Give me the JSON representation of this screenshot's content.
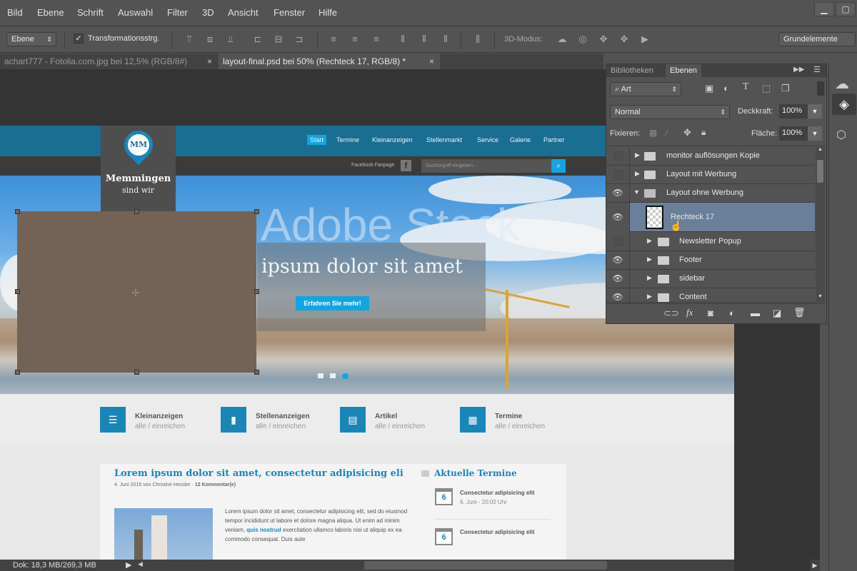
{
  "menubar": {
    "items": [
      "Bild",
      "Ebene",
      "Schrift",
      "Auswahl",
      "Filter",
      "3D",
      "Ansicht",
      "Fenster",
      "Hilfe"
    ],
    "minimize_icon": "minimize-icon",
    "maximize_icon": "maximize-icon"
  },
  "options": {
    "tool_select": "Ebene",
    "transform_label": "Transformationsstrg.",
    "transform_checked": true,
    "mode3d_label": "3D-Modus:",
    "workspace": "Grundelemente"
  },
  "tabs": [
    {
      "label": "achart777 - Fotolia.com.jpg bei 12,5% (RGB/8#)",
      "active": false
    },
    {
      "label": "layout-final.psd bei 50% (Rechteck 17, RGB/8) *",
      "active": true
    }
  ],
  "website": {
    "nav": [
      "Start",
      "Termine",
      "Kleinanzeigen",
      "Stellenmarkt",
      "Service",
      "Galerie",
      "Partner"
    ],
    "facebook_label": "Facebook Fanpage",
    "search_placeholder": "Suchbegriff eingeben...",
    "logo_initials": "MM",
    "logo_title": "Memmingen",
    "logo_subtitle": "sind wir",
    "hero_watermark": "Adobe Stock",
    "hero_title": "n ipsum dolor sit amet",
    "hero_button": "Erfahren Sie mehr!",
    "features": [
      {
        "title": "Kleinanzeigen",
        "sub": "alle / einreichen",
        "icon": "list-icon"
      },
      {
        "title": "Stellenanzeigen",
        "sub": "alle / einreichen",
        "icon": "briefcase-icon"
      },
      {
        "title": "Artikel",
        "sub": "alle / einreichen",
        "icon": "article-icon"
      },
      {
        "title": "Termine",
        "sub": "alle / einreichen",
        "icon": "calendar-icon"
      }
    ],
    "post": {
      "title": "Lorem ipsum dolor sit amet, consectetur adipisicing eli",
      "meta": "4. Juni 2015 von Christine Hessler · ",
      "comments": "12 Kommentar(e)",
      "body1": "Lorem ipsum dolor sit amet, consectetur adipisicing elit, sed do eiusmod tempor incididunt ut labore et dolore magna aliqua. Ut enim ad minim veniam, ",
      "body_link": "quis nostrud",
      "body2": " exercitation ullamco laboris nisi ut aliquip ex ea commodo consequat. Duis aute"
    },
    "sidebar": {
      "title": "Aktuelle Termine",
      "events": [
        {
          "day": "6",
          "title": "Consectetur adipisicing elit",
          "date": "6. Juni - 20:00 Uhr"
        },
        {
          "day": "6",
          "title": "Consectetur adipisicing elit",
          "date": ""
        }
      ]
    }
  },
  "layers_panel": {
    "tabs": [
      "Bibliotheken",
      "Ebenen"
    ],
    "active_tab": "Ebenen",
    "filter": "Art",
    "blend_mode": "Normal",
    "opacity_label": "Deckkraft:",
    "opacity": "100%",
    "lock_label": "Fixieren:",
    "fill_label": "Fläche:",
    "fill": "100%",
    "layers": [
      {
        "name": "monitor auflösungen Kopie",
        "visible": false,
        "type": "group",
        "expanded": false,
        "indent": 0
      },
      {
        "name": "Layout mit Werbung",
        "visible": false,
        "type": "group",
        "expanded": false,
        "indent": 0
      },
      {
        "name": "Layout ohne Werbung",
        "visible": true,
        "type": "group",
        "expanded": true,
        "indent": 0
      },
      {
        "name": "Rechteck 17",
        "visible": true,
        "type": "shape",
        "selected": true,
        "indent": 1
      },
      {
        "name": "Newsletter Popup",
        "visible": false,
        "type": "group",
        "expanded": false,
        "indent": 1
      },
      {
        "name": "Footer",
        "visible": true,
        "type": "group",
        "expanded": false,
        "indent": 1
      },
      {
        "name": "sidebar",
        "visible": true,
        "type": "group",
        "expanded": false,
        "indent": 1
      },
      {
        "name": "Content",
        "visible": true,
        "type": "group",
        "expanded": false,
        "indent": 1
      }
    ]
  },
  "statusbar": {
    "doc_info": "Dok: 18,3 MB/269,3 MB"
  },
  "colors": {
    "selection": "#6a7f99",
    "rect_fill": "#736357",
    "site_blue": "#1a6e91",
    "accent": "#12a5e0"
  }
}
